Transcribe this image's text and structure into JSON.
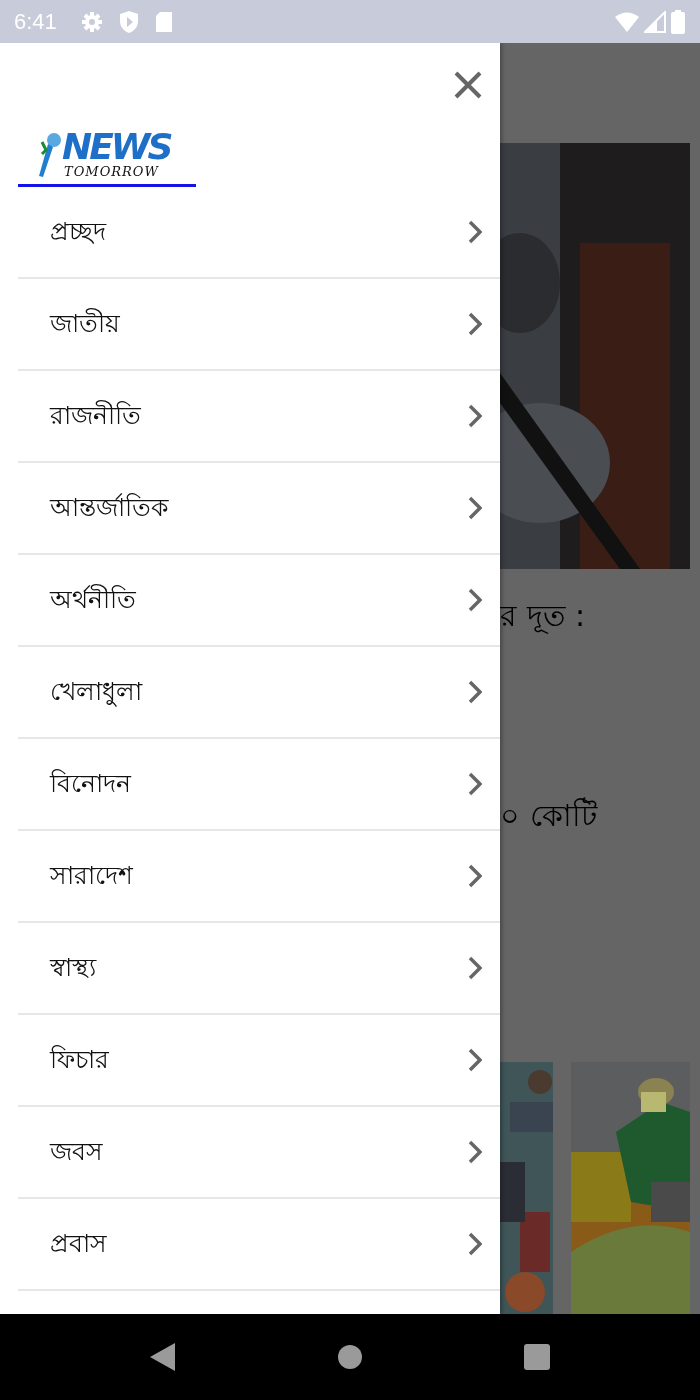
{
  "status_bar": {
    "time": "6:41"
  },
  "drawer": {
    "logo": {
      "word": "NEWS",
      "tagline": "TOMORROW"
    },
    "items": [
      {
        "label": "প্রচ্ছদ"
      },
      {
        "label": "জাতীয়"
      },
      {
        "label": "রাজনীতি"
      },
      {
        "label": "আন্তর্জাতিক"
      },
      {
        "label": "অর্থনীতি"
      },
      {
        "label": "খেলাধুলা"
      },
      {
        "label": "বিনোদন"
      },
      {
        "label": "সারাদেশ"
      },
      {
        "label": "স্বাস্থ্য"
      },
      {
        "label": "ফিচার"
      },
      {
        "label": "জবস"
      },
      {
        "label": "প্রবাস"
      }
    ]
  },
  "background": {
    "headlines": [
      "র দূত :",
      "০ কোটি"
    ]
  }
}
